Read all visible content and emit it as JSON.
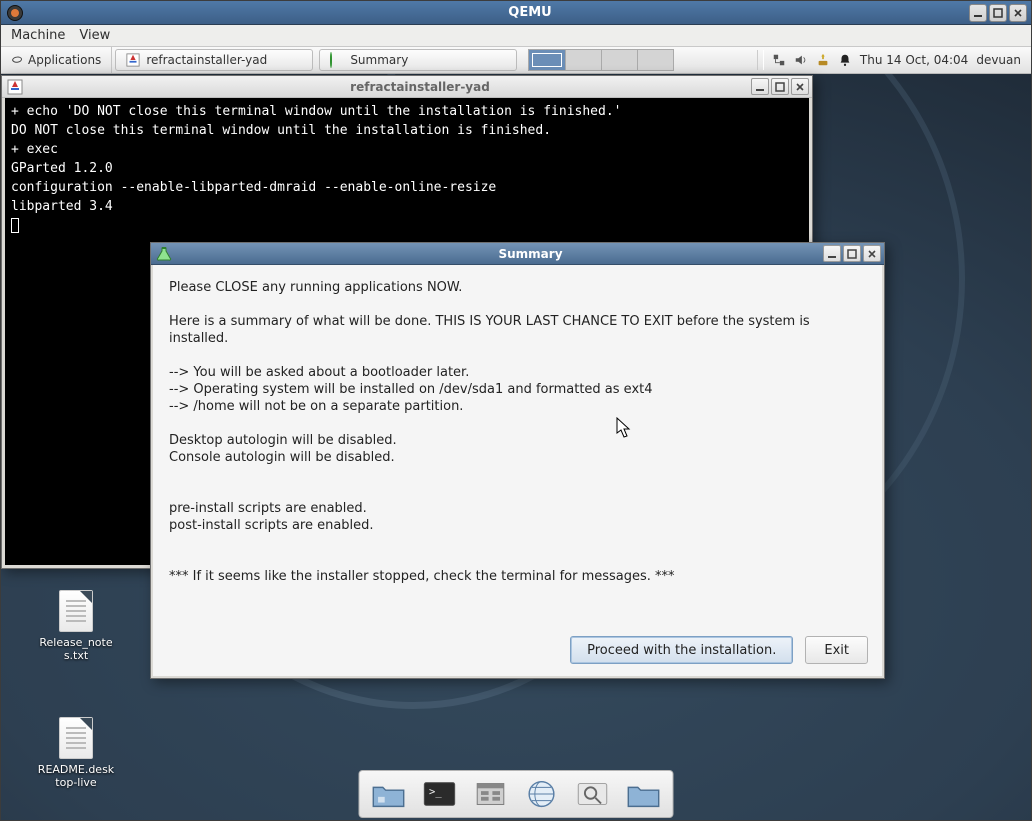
{
  "qemu": {
    "title": "QEMU",
    "menu": {
      "machine": "Machine",
      "view": "View"
    }
  },
  "panel": {
    "apps_label": "Applications",
    "tasks": [
      {
        "label": "refractainstaller-yad",
        "icon": "installer"
      },
      {
        "label": "Summary",
        "icon": "green-dot"
      }
    ],
    "clock": "Thu 14 Oct, 04:04",
    "user": "devuan"
  },
  "desktop_icons": [
    {
      "label": "Release_note\ns.txt"
    },
    {
      "label": "README.desk\ntop-live"
    }
  ],
  "terminal": {
    "title": "refractainstaller-yad",
    "lines": "+ echo 'DO NOT close this terminal window until the installation is finished.'\nDO NOT close this terminal window until the installation is finished.\n+ exec\nGParted 1.2.0\nconfiguration --enable-libparted-dmraid --enable-online-resize\nlibparted 3.4"
  },
  "dialog": {
    "title": "Summary",
    "body": "Please CLOSE any running applications NOW.\n\nHere is a summary of what will be done. THIS IS YOUR LAST CHANCE TO EXIT before the system is installed.\n\n--> You will be asked about a bootloader later.\n--> Operating system will be installed on /dev/sda1 and formatted as ext4\n--> /home will not be on a separate partition.\n\nDesktop autologin will be disabled.\nConsole autologin will be disabled.\n\n\npre-install scripts are enabled.\npost-install scripts are enabled.\n\n\n*** If it seems like the installer stopped, check the terminal for messages. ***",
    "proceed": "Proceed with the installation.",
    "exit": "Exit"
  }
}
